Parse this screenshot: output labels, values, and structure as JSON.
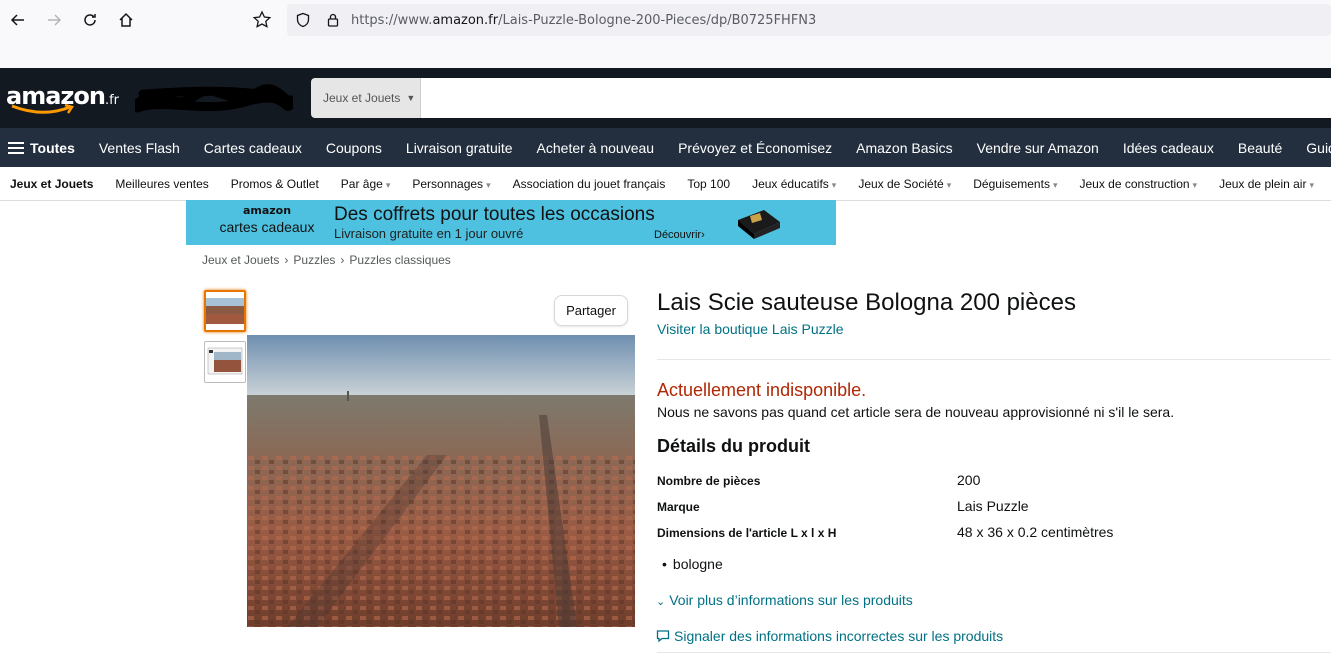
{
  "browser": {
    "url_prefix": "https://www.",
    "url_domain": "amazon.fr",
    "url_path": "/Lais-Puzzle-Bologne-200-Pieces/dp/B0725FHFN3"
  },
  "header": {
    "logo_text": "amazon",
    "logo_tld": ".fr",
    "search_category": "Jeux et Jouets",
    "search_placeholder": ""
  },
  "main_nav": {
    "all_label": "Toutes",
    "items": [
      "Ventes Flash",
      "Cartes cadeaux",
      "Coupons",
      "Livraison gratuite",
      "Acheter à nouveau",
      "Prévoyez et Économisez",
      "Amazon Basics",
      "Vendre sur Amazon",
      "Idées cadeaux",
      "Beauté",
      "Guide"
    ]
  },
  "sub_nav": {
    "items": [
      {
        "label": "Jeux et Jouets",
        "dropdown": false
      },
      {
        "label": "Meilleures ventes",
        "dropdown": false
      },
      {
        "label": "Promos & Outlet",
        "dropdown": false
      },
      {
        "label": "Par âge",
        "dropdown": true
      },
      {
        "label": "Personnages",
        "dropdown": true
      },
      {
        "label": "Association du jouet français",
        "dropdown": false
      },
      {
        "label": "Top 100",
        "dropdown": false
      },
      {
        "label": "Jeux éducatifs",
        "dropdown": true
      },
      {
        "label": "Jeux de Société",
        "dropdown": true
      },
      {
        "label": "Déguisements",
        "dropdown": true
      },
      {
        "label": "Jeux de construction",
        "dropdown": true
      },
      {
        "label": "Jeux de plein air",
        "dropdown": true
      }
    ]
  },
  "banner": {
    "logo_line1": "amazon",
    "logo_line2": "cartes cadeaux",
    "title": "Des coffrets pour toutes les occasions",
    "subtitle": "Livraison gratuite en 1 jour ouvré",
    "cta": "Découvrir›"
  },
  "breadcrumb": [
    "Jeux et Jouets",
    "Puzzles",
    "Puzzles classiques"
  ],
  "product": {
    "share_label": "Partager",
    "title": "Lais Scie sauteuse Bologna 200 pièces",
    "store_link": "Visiter la boutique Lais Puzzle",
    "availability": "Actuellement indisponible.",
    "availability_msg": "Nous ne savons pas quand cet article sera de nouveau approvisionné ni s'il le sera.",
    "details_title": "Détails du produit",
    "details": [
      {
        "key": "Nombre de pièces",
        "value": "200"
      },
      {
        "key": "Marque",
        "value": "Lais Puzzle"
      },
      {
        "key": "Dimensions de l'article L x l x H",
        "value": "48 x 36 x 0.2 centimètres"
      }
    ],
    "bullets": [
      "bologne"
    ],
    "more_link": "Voir plus d’informations sur les produits",
    "report_link": "Signaler des informations incorrectes sur les produits"
  },
  "colors": {
    "header_bg": "#131921",
    "nav_bg": "#232f3e",
    "banner_bg": "#4dc1df",
    "link": "#007185",
    "unavailable": "#b12704",
    "thumb_active": "#e77600"
  }
}
